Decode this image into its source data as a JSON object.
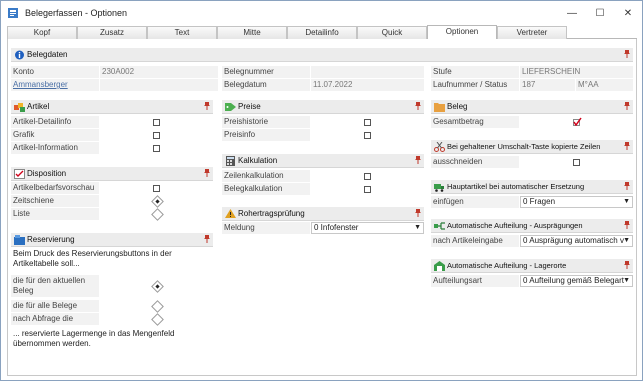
{
  "window": {
    "title": "Belegerfassen - Optionen",
    "minimize": "—",
    "maximize": "☐",
    "close": "✕"
  },
  "tabs": [
    "Kopf",
    "Zusatz",
    "Text",
    "Mitte",
    "Detailinfo",
    "Quick",
    "Optionen",
    "Vertreter"
  ],
  "active_tab": "Optionen",
  "belegdaten": {
    "title": "Belegdaten",
    "konto_label": "Konto",
    "konto_value": "230A002",
    "name_link": "Ammansberger",
    "belegnummer_label": "Belegnummer",
    "belegnummer_value": "",
    "belegdatum_label": "Belegdatum",
    "belegdatum_value": "11.07.2022",
    "stufe_label": "Stufe",
    "stufe_value": "LIEFERSCHEIN",
    "laufnummer_label": "Laufnummer / Status",
    "laufnummer_value": "187",
    "status_value": "M°AA"
  },
  "artikel": {
    "title": "Artikel",
    "rows": [
      "Artikel-Detailinfo",
      "Grafik",
      "Artikel-Information"
    ]
  },
  "disposition": {
    "title": "Disposition",
    "rows": [
      "Artikelbedarfsvorschau",
      "Zeitschiene",
      "Liste"
    ]
  },
  "reservierung": {
    "title": "Reservierung",
    "intro": "Beim Druck des Reservierungsbuttons in der Artikeltabelle soll...",
    "opt1": "die für den aktuellen Beleg",
    "opt2": "die für alle Belege",
    "opt3": "nach Abfrage die",
    "outro": "... reservierte Lagermenge in das Mengenfeld übernommen werden."
  },
  "preise": {
    "title": "Preise",
    "rows": [
      "Preishistorie",
      "Preisinfo"
    ]
  },
  "kalkulation": {
    "title": "Kalkulation",
    "rows": [
      "Zeilenkalkulation",
      "Belegkalkulation"
    ]
  },
  "rohertrag": {
    "title": "Rohertragsprüfung",
    "meldung_label": "Meldung",
    "meldung_value": "0 Infofenster"
  },
  "beleg": {
    "title": "Beleg",
    "gesamtbetrag": "Gesamtbetrag"
  },
  "umschalt": {
    "title": "Bei gehaltener Umschalt-Taste kopierte Zeilen",
    "ausschneiden": "ausschneiden"
  },
  "hauptartikel": {
    "title": "Hauptartikel bei automatischer Ersetzung",
    "einfuegen_label": "einfügen",
    "einfuegen_value": "0 Fragen"
  },
  "aufteilung_auspr": {
    "title": "Automatische Aufteilung - Ausprägungen",
    "label": "nach Artikeleingabe",
    "value": "0 Ausprägung automatisch v"
  },
  "aufteilung_lager": {
    "title": "Automatische Aufteilung - Lagerorte",
    "label": "Aufteilungsart",
    "value": "0 Aufteilung gemäß Belegart"
  },
  "colors": {
    "section_bg": "#ececec",
    "pin": "#c0392b",
    "checkmark": "#d0021b",
    "link": "#4a6fa5"
  }
}
